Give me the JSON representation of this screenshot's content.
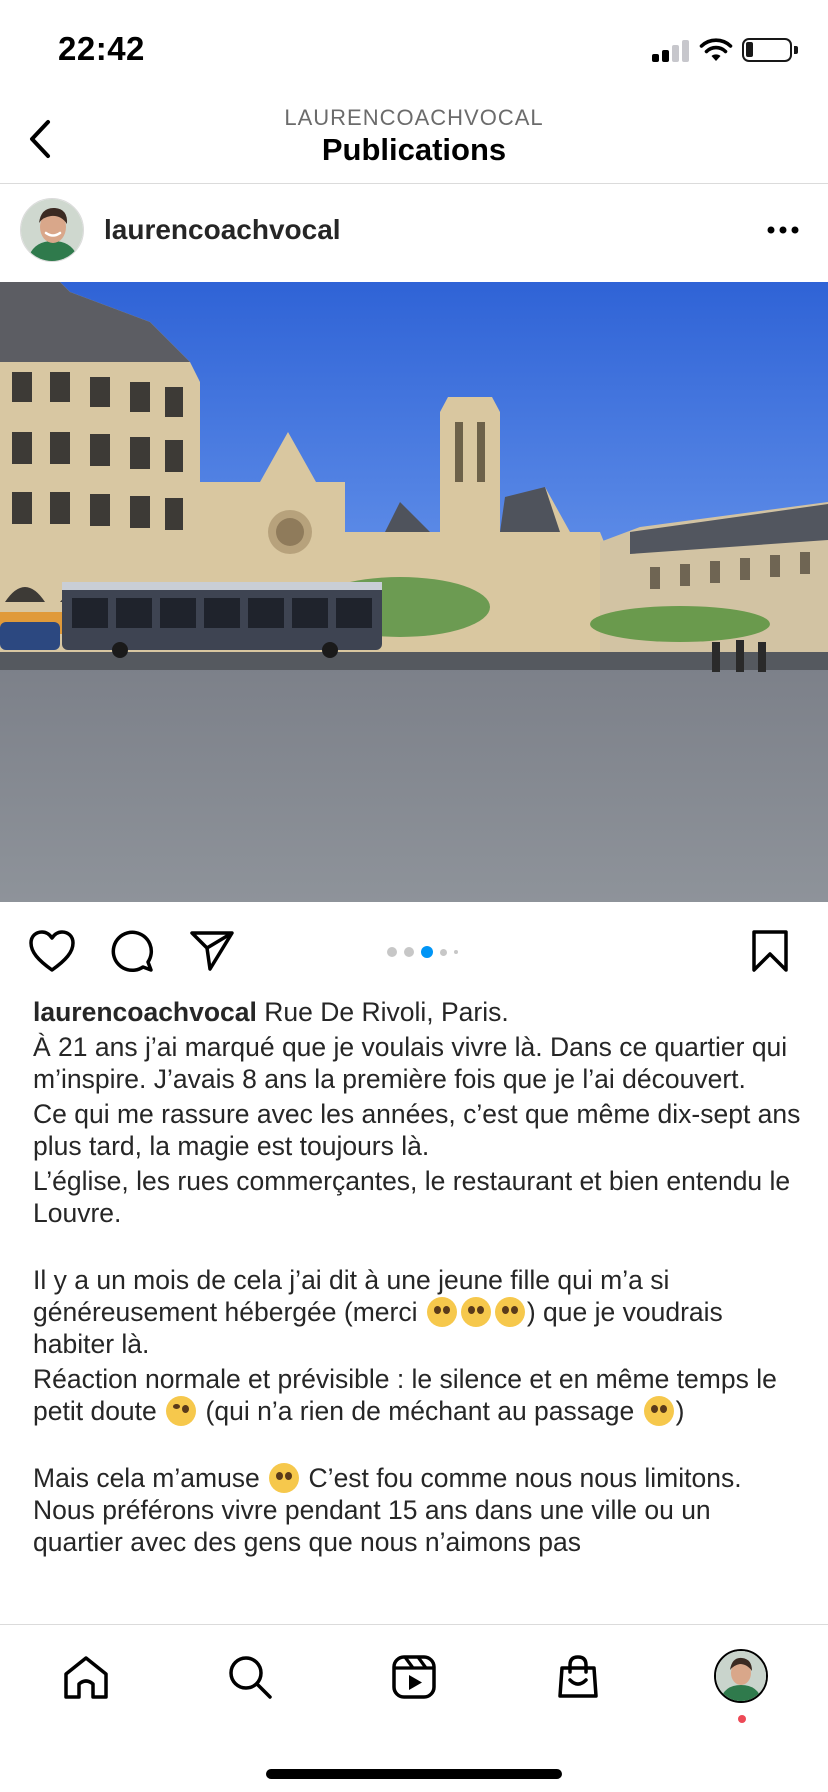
{
  "status_bar": {
    "time": "22:42"
  },
  "header": {
    "account": "LAURENCOACHVOCAL",
    "title": "Publications"
  },
  "post": {
    "username": "laurencoachvocal",
    "carousel": {
      "count": 5,
      "active_index": 2
    },
    "caption": {
      "username": "laurencoachvocal",
      "p1": "Rue De Rivoli, Paris.",
      "p2": "À 21 ans j’ai marqué que je voulais vivre là. Dans ce quartier qui m’inspire. J’avais 8 ans la première fois que je l’ai découvert.",
      "p3": "Ce qui me rassure avec les années, c’est que même dix-sept ans plus tard, la magie est toujours là.",
      "p4": "L’église, les rues commerçantes, le restaurant et bien entendu le Louvre.",
      "p5a": "Il y a un mois de cela j’ai dit à une jeune fille qui m’a si généreusement hébergée (merci",
      "p5b": ") que je voudrais habiter là.",
      "p6a": "Réaction normale et prévisible : le silence et en même temps le petit doute",
      "p6b": "(qui n’a rien de méchant au passage",
      "p6c": ")",
      "p7a": "Mais cela m’amuse",
      "p7b": "C’est fou comme nous nous limitons. Nous préférons vivre pendant 15 ans dans une ville ou un quartier avec des gens que nous n’aimons pas"
    }
  },
  "tabs": [
    "home-icon",
    "search-icon",
    "reels-icon",
    "shop-icon",
    "profile-avatar"
  ],
  "colors": {
    "accent": "#0095f6",
    "notification": "#ed4956",
    "divider": "#dbdbdb"
  }
}
